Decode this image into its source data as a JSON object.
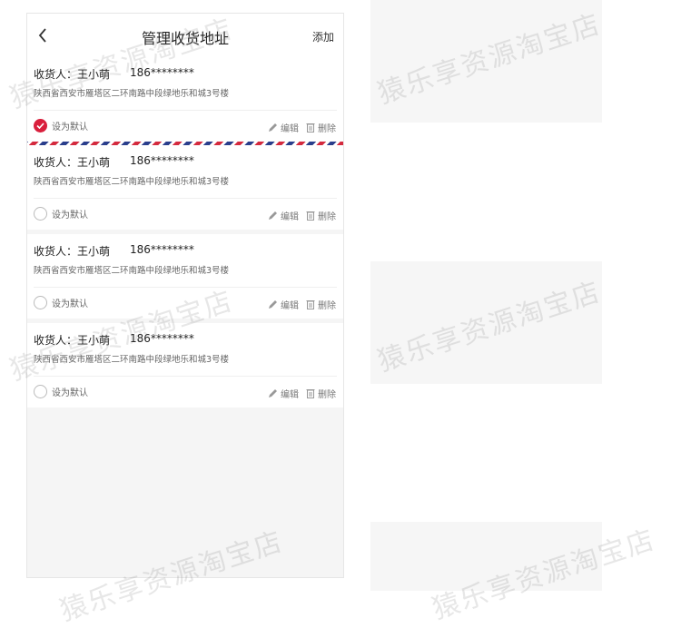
{
  "navbar": {
    "title": "管理收货地址",
    "add_label": "添加"
  },
  "addresses": [
    {
      "name_label": "收货人：王小萌",
      "phone": "186********",
      "address": "陕西省西安市雁塔区二环南路中段绿地乐和城3号楼",
      "default_label": "设为默认",
      "is_default": true
    },
    {
      "name_label": "收货人：王小萌",
      "phone": "186********",
      "address": "陕西省西安市雁塔区二环南路中段绿地乐和城3号楼",
      "default_label": "设为默认",
      "is_default": false
    },
    {
      "name_label": "收货人：王小萌",
      "phone": "186********",
      "address": "陕西省西安市雁塔区二环南路中段绿地乐和城3号楼",
      "default_label": "设为默认",
      "is_default": false
    },
    {
      "name_label": "收货人：王小萌",
      "phone": "186********",
      "address": "陕西省西安市雁塔区二环南路中段绿地乐和城3号楼",
      "default_label": "设为默认",
      "is_default": false
    }
  ],
  "actions": {
    "edit_label": "编辑",
    "delete_label": "删除"
  },
  "watermark": {
    "text": "猿乐享资源淘宝店"
  },
  "colors": {
    "accent": "#d91f3c",
    "airmail_blue": "#2a3e8c",
    "background": "#f5f5f5"
  },
  "icons": [
    "chevron-left-icon",
    "check-circle-icon",
    "pencil-icon",
    "trash-icon"
  ]
}
